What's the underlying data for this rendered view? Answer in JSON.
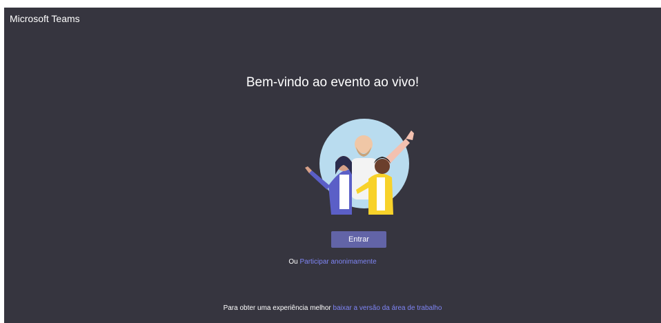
{
  "window": {
    "title": "Microsoft Teams"
  },
  "main": {
    "welcome_heading": "Bem-vindo ao evento ao vivo!",
    "illustration_icon": "people-waving-illustration",
    "join_button_label": "Entrar",
    "anonymous_prefix": "Ou",
    "anonymous_link": "Participar anonimamente"
  },
  "footer": {
    "prefix": "Para obter uma experiência melhor",
    "link": "baixar a versão da área de trabalho"
  },
  "colors": {
    "background": "#36353f",
    "accent": "#6264a7",
    "link": "#7f85f5"
  }
}
